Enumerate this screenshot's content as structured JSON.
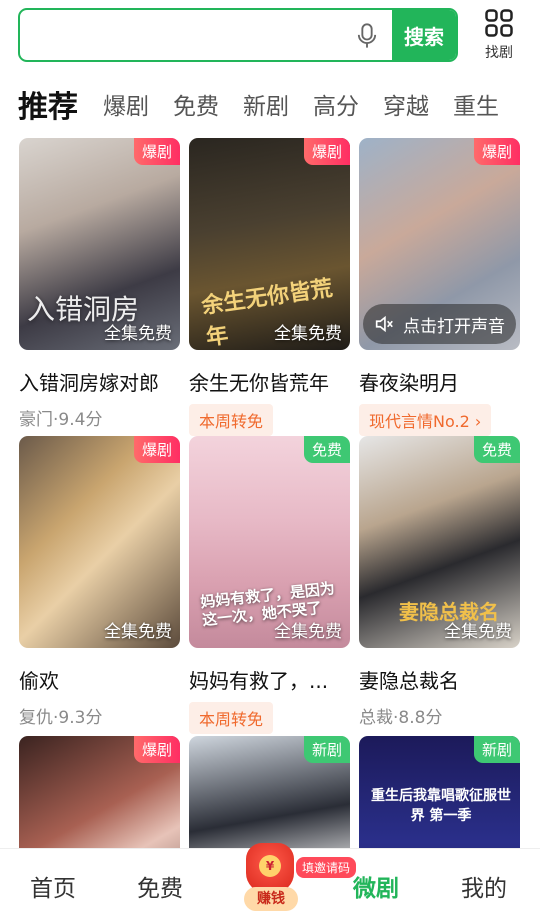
{
  "search": {
    "placeholder": "",
    "button_label": "搜索"
  },
  "finder": {
    "label": "找剧"
  },
  "tabs": [
    "推荐",
    "爆剧",
    "免费",
    "新剧",
    "高分",
    "穿越",
    "重生"
  ],
  "colors": {
    "accent": "#22b55a",
    "hot_tag": "#ff2e63",
    "free_tag": "#3ec873",
    "pill_text": "#f06a2e"
  },
  "cards": [
    {
      "title": "入错洞房嫁对郎",
      "tag": "爆剧",
      "overlay": "全集免费",
      "meta": "豪门·9.4分",
      "pill": ""
    },
    {
      "title": "余生无你皆荒年",
      "tag": "爆剧",
      "overlay": "全集免费",
      "meta": "",
      "pill": "本周转免"
    },
    {
      "title": "春夜染明月",
      "tag": "爆剧",
      "overlay": "",
      "sound": "点击打开声音",
      "meta": "",
      "pill": "现代言情No.2 ›"
    },
    {
      "title": "偷欢",
      "tag": "爆剧",
      "overlay": "全集免费",
      "meta": "复仇·9.3分",
      "pill": ""
    },
    {
      "title": "妈妈有救了，...",
      "tag": "免费",
      "overlay": "全集免费",
      "meta": "",
      "pill": "本周转免"
    },
    {
      "title": "妻隐总裁名",
      "tag": "免费",
      "overlay": "全集免费",
      "meta": "总裁·8.8分",
      "pill": ""
    },
    {
      "title": "",
      "tag": "爆剧",
      "overlay": "",
      "meta": "",
      "pill": ""
    },
    {
      "title": "",
      "tag": "新剧",
      "overlay": "",
      "meta": "",
      "pill": ""
    },
    {
      "title": "",
      "tag": "新剧",
      "overlay": "",
      "meta": "",
      "pill": "",
      "cover_text": "重生后我靠唱歌征服世界 第一季"
    }
  ],
  "cover_texts": {
    "c0": "入错洞房",
    "c1": "余生无你皆荒年",
    "c4": "妈妈有救了，是因为这一次，她不哭了",
    "c5": "妻隐总裁名"
  },
  "bottom_nav": {
    "home": "首页",
    "free": "免费",
    "earn": "赚钱",
    "earn_coin": "¥",
    "invite": "填邀请码",
    "drama": "微剧",
    "mine": "我的"
  }
}
